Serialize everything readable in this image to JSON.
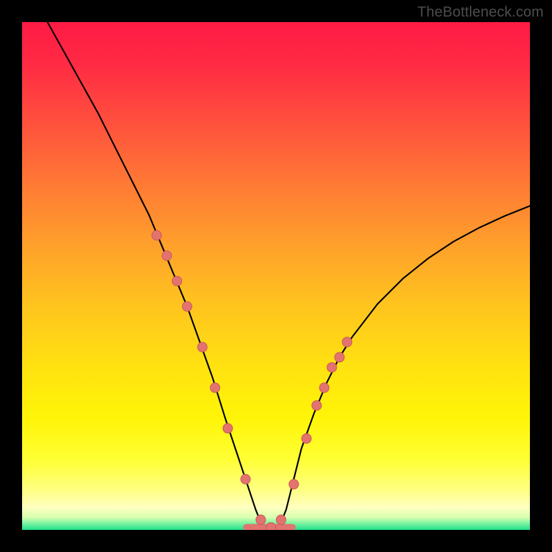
{
  "watermark": "TheBottleneck.com",
  "colors": {
    "gradient_stops": [
      {
        "offset": 0.0,
        "color": "#ff1a45"
      },
      {
        "offset": 0.08,
        "color": "#ff2a44"
      },
      {
        "offset": 0.18,
        "color": "#ff4a3e"
      },
      {
        "offset": 0.3,
        "color": "#ff7336"
      },
      {
        "offset": 0.42,
        "color": "#ff9a2d"
      },
      {
        "offset": 0.55,
        "color": "#ffc21f"
      },
      {
        "offset": 0.68,
        "color": "#ffe210"
      },
      {
        "offset": 0.78,
        "color": "#fff508"
      },
      {
        "offset": 0.86,
        "color": "#ffff33"
      },
      {
        "offset": 0.92,
        "color": "#ffff80"
      },
      {
        "offset": 0.955,
        "color": "#ffffc0"
      },
      {
        "offset": 0.975,
        "color": "#d9ffb0"
      },
      {
        "offset": 0.99,
        "color": "#66f09e"
      },
      {
        "offset": 1.0,
        "color": "#1fdf8a"
      }
    ],
    "curve": "#000000",
    "marker_fill": "#e3736f",
    "marker_stroke": "#c95a57"
  },
  "chart_data": {
    "type": "line",
    "title": "",
    "xlabel": "",
    "ylabel": "",
    "xlim": [
      0,
      100
    ],
    "ylim": [
      0,
      100
    ],
    "series": [
      {
        "name": "bottleneck-curve",
        "x": [
          5,
          10,
          15,
          20,
          22.5,
          25,
          27.5,
          30,
          32.5,
          35,
          37.5,
          40,
          41,
          42,
          43,
          44,
          45,
          46,
          47,
          48,
          49,
          50,
          51,
          52,
          53,
          54,
          55,
          57.5,
          60,
          62.5,
          65,
          70,
          75,
          80,
          85,
          90,
          95,
          100
        ],
        "values": [
          100,
          91,
          82,
          72,
          67,
          62,
          56,
          50,
          44,
          37,
          30,
          22,
          19,
          16,
          13,
          10,
          7,
          4,
          1.5,
          0.5,
          0.5,
          0.5,
          1.5,
          4,
          8,
          12,
          16,
          23,
          29,
          34,
          38,
          44.5,
          49.5,
          53.5,
          56.8,
          59.5,
          61.8,
          63.8
        ]
      }
    ],
    "markers": {
      "name": "highlighted-points",
      "x": [
        26.5,
        28.5,
        30.5,
        32.5,
        35.5,
        38,
        40.5,
        44,
        47,
        49,
        51,
        53.5,
        56,
        58,
        59.5,
        61,
        62.5,
        64
      ],
      "values": [
        58,
        54,
        49,
        44,
        36,
        28,
        20,
        10,
        2,
        0.5,
        2,
        9,
        18,
        24.5,
        28,
        32,
        34,
        37
      ]
    },
    "flat_segment": {
      "x_start": 44.2,
      "x_end": 53.2,
      "y": 0.5
    }
  }
}
